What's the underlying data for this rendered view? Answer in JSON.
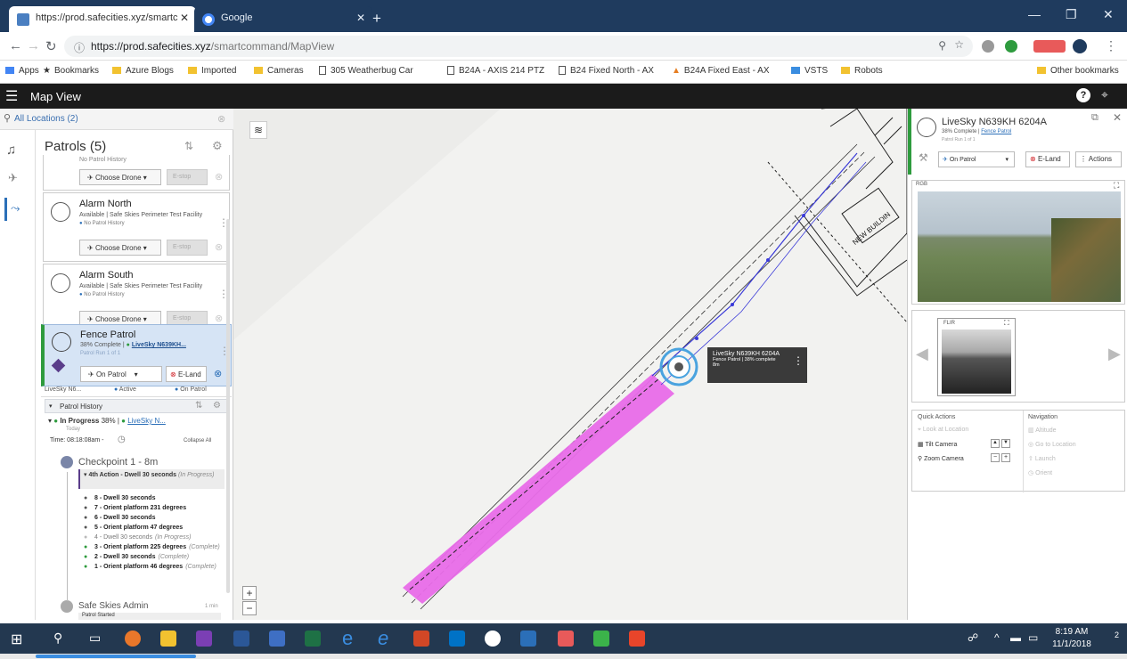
{
  "browser": {
    "tabs": [
      {
        "title": "https://prod.safecities.xyz/smartc"
      },
      {
        "title": "Google"
      }
    ],
    "url_domain": "https://prod.safecities.xyz",
    "url_path": "/smartcommand/MapView",
    "bookmarks": [
      "Apps",
      "Bookmarks",
      "Azure Blogs",
      "Imported",
      "Cameras",
      "305 Weatherbug Car",
      "B24A - AXIS 214 PTZ",
      "B24 Fixed North - AX",
      "B24A Fixed East - AX",
      "VSTS",
      "Robots",
      "Other bookmarks"
    ]
  },
  "app": {
    "title": "Map View",
    "help_label": "?"
  },
  "locations": {
    "label": "All Locations (2)"
  },
  "patrols": {
    "header": "Patrols (5)",
    "cards": [
      {
        "history": "No Patrol History",
        "drone_button": "Choose Drone",
        "estop": "E-stop"
      },
      {
        "name": "Alarm North",
        "status": "Available | Safe Skies Perimeter Test Facility",
        "history": "No Patrol History",
        "drone_button": "Choose Drone",
        "estop": "E-stop"
      },
      {
        "name": "Alarm South",
        "status": "Available | Safe Skies Perimeter Test Facility",
        "history": "No Patrol History",
        "drone_button": "Choose Drone",
        "estop": "E-stop"
      },
      {
        "name": "Fence Patrol",
        "status_prefix": "38% Complete |",
        "status_link": "LiveSky N639KH...",
        "run": "Patrol Run 1 of 1",
        "drone_button": "On Patrol",
        "eland": "E-Land"
      }
    ],
    "chips": [
      "LiveSky N6...",
      "Active",
      "On Patrol"
    ],
    "history": {
      "header": "Patrol History",
      "entry_status": "In Progress",
      "entry_percent": "38% |",
      "entry_link": "LiveSky N...",
      "entry_day": "Today",
      "time_label": "Time: 08:18:08am -",
      "collapse_label": "Collapse All",
      "checkpoint": "Checkpoint 1 - 8m",
      "current_action": "4th Action - Dwell 30 seconds",
      "current_action_state": "(In Progress)",
      "actions": [
        {
          "label": "8 - Dwell 30 seconds",
          "note": "",
          "state": "pending"
        },
        {
          "label": "7 - Orient platform 231 degrees",
          "note": "",
          "state": "pending"
        },
        {
          "label": "6 - Dwell 30 seconds",
          "note": "",
          "state": "pending"
        },
        {
          "label": "5 - Orient platform 47 degrees",
          "note": "",
          "state": "pending"
        },
        {
          "label": "4 - Dwell 30 seconds",
          "note": "(In Progress)",
          "state": "progress"
        },
        {
          "label": "3 - Orient platform 225 degrees",
          "note": "(Complete)",
          "state": "done"
        },
        {
          "label": "2 - Dwell 30 seconds",
          "note": "(Complete)",
          "state": "done"
        },
        {
          "label": "1 - Orient platform 46 degrees",
          "note": "(Complete)",
          "state": "done"
        }
      ],
      "admin_name": "Safe Skies Admin",
      "admin_time": "1 min",
      "admin_note": "Patrol Started"
    }
  },
  "map": {
    "building_label": "NEW BUILDIN",
    "drone_popup": {
      "title": "LiveSky N639KH 6204A",
      "line2": "Fence Patrol | 38% complete",
      "line3": "8m"
    },
    "zoom_in": "+",
    "zoom_out": "−"
  },
  "drone_panel": {
    "title": "LiveSky N639KH 6204A",
    "subtitle_prefix": "38% Complete |",
    "subtitle_link": "Fence Patrol",
    "run": "Patrol Run 1 of 1",
    "status_select": "On Patrol",
    "eland": "E-Land",
    "actions": "Actions",
    "rgb_label": "RGB",
    "flir_label": "FLIR",
    "quick_actions": {
      "header": "Quick Actions",
      "items": [
        "Look at Location",
        "Tilt Camera",
        "Zoom Camera"
      ]
    },
    "navigation": {
      "header": "Navigation",
      "items": [
        "Altitude",
        "Go to Location",
        "Launch",
        "Orient"
      ]
    }
  },
  "taskbar": {
    "time": "8:19 AM",
    "date": "11/1/2018",
    "notifications": "2"
  },
  "colors": {
    "chrome_bg": "#1f3b5e",
    "app_header": "#1b1b1b",
    "selected_card": "#d6e4f5",
    "patrol_path": "#e86ce8",
    "route_line": "#3a3ad8",
    "green": "#2e9b3e",
    "red": "#d0242a"
  }
}
